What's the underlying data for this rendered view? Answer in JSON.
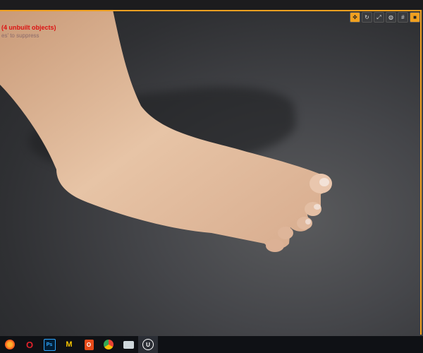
{
  "viewport": {
    "warning": "(4 unbuilt objects)",
    "hint": "es' to suppress",
    "toolbar": [
      {
        "icon": "transform-icon",
        "active": true
      },
      {
        "icon": "rotate-icon",
        "active": false
      },
      {
        "icon": "scale-icon",
        "active": false
      },
      {
        "icon": "globe-icon",
        "active": false
      },
      {
        "icon": "grid-snap-icon",
        "active": false
      },
      {
        "icon": "camera-speed-icon",
        "active": true
      }
    ]
  },
  "taskbar": {
    "items": [
      {
        "name": "firefox-icon",
        "label": "",
        "color": "#ff7a1a"
      },
      {
        "name": "opera-icon",
        "label": "O",
        "color": "#e0222b"
      },
      {
        "name": "photoshop-icon",
        "label": "Ps",
        "color": "#31a8ff"
      },
      {
        "name": "marmoset-icon",
        "label": "M",
        "color": "#f5c400"
      },
      {
        "name": "office-icon",
        "label": "O",
        "color": "#e64a19"
      },
      {
        "name": "chrome-icon",
        "label": "",
        "color": "#4caf50"
      },
      {
        "name": "files-icon",
        "label": "",
        "color": "#cfd8dc"
      },
      {
        "name": "unreal-icon",
        "label": "U",
        "color": "#ffffff"
      }
    ]
  }
}
